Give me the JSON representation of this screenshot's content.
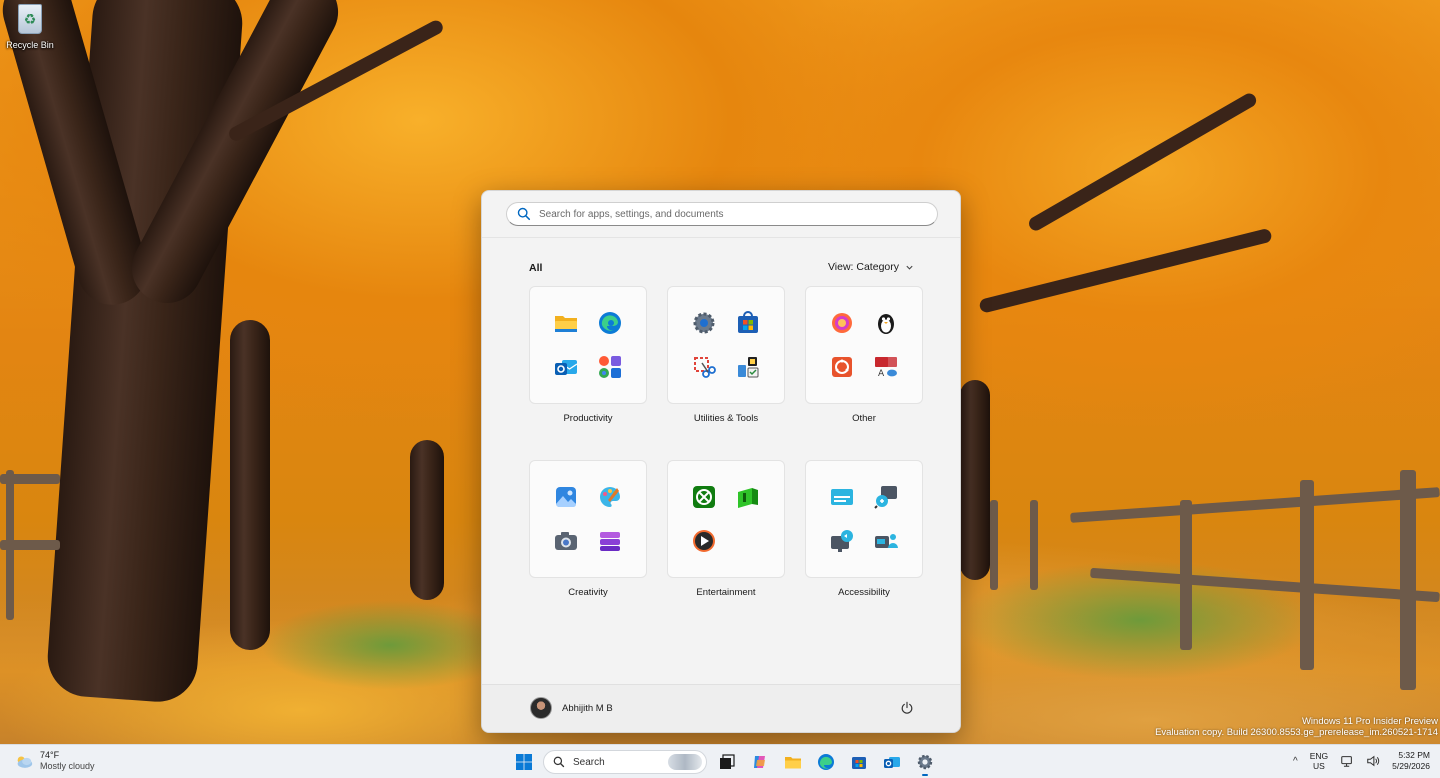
{
  "desktop": {
    "recycle_bin_label": "Recycle Bin",
    "watermark_line1": "Windows 11 Pro Insider Preview",
    "watermark_line2": "Evaluation copy. Build 26300.8553.ge_prerelease_im.260521-1714"
  },
  "start_menu": {
    "search_placeholder": "Search for apps, settings, and documents",
    "all_label": "All",
    "view_label": "View: Category",
    "categories": [
      {
        "label": "Productivity",
        "apps": [
          "file-explorer-icon",
          "edge-icon",
          "outlook-icon",
          "office-apps-icon"
        ]
      },
      {
        "label": "Utilities & Tools",
        "apps": [
          "settings-icon",
          "microsoft-store-icon",
          "snipping-tool-icon",
          "task-tools-icon"
        ]
      },
      {
        "label": "Other",
        "apps": [
          "copilot-orb-icon",
          "penguin-app-icon",
          "office-icon",
          "translator-icon"
        ]
      },
      {
        "label": "Creativity",
        "apps": [
          "photos-icon",
          "paint-icon",
          "camera-icon",
          "clipchamp-icon"
        ]
      },
      {
        "label": "Entertainment",
        "apps": [
          "xbox-icon",
          "game-pass-icon",
          "media-player-icon"
        ]
      },
      {
        "label": "Accessibility",
        "apps": [
          "live-captions-icon",
          "magnifier-icon",
          "narrator-icon",
          "voice-access-icon"
        ]
      }
    ],
    "user_name": "Abhijith M B"
  },
  "taskbar": {
    "weather_temp": "74°F",
    "weather_desc": "Mostly cloudy",
    "search_label": "Search",
    "lang_line1": "ENG",
    "lang_line2": "US",
    "time": "5:32 PM",
    "date": "5/29/2026"
  },
  "colors": {
    "accent": "#0067c0",
    "start_bg": "#f3f3f3",
    "taskbar_bg": "#eef1f5"
  }
}
